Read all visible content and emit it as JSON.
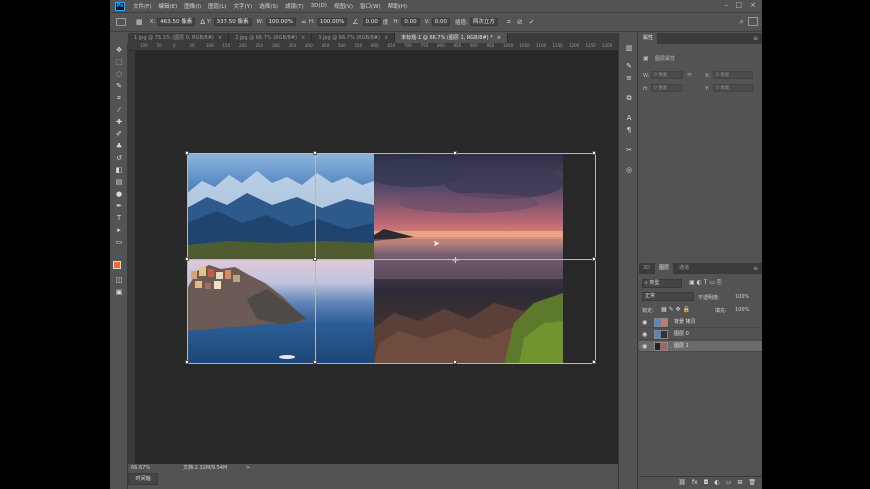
{
  "menu": {
    "items": [
      "文件(F)",
      "编辑(E)",
      "图像(I)",
      "图层(L)",
      "文字(Y)",
      "选择(S)",
      "滤镜(T)",
      "3D(D)",
      "视图(V)",
      "窗口(W)",
      "帮助(H)"
    ],
    "logo": "Ps"
  },
  "options": {
    "x_label": "X:",
    "x_value": "463.50 像素",
    "y_label": "Y:",
    "y_value": "337.50 像素",
    "w_label": "W:",
    "w_value": "100.00%",
    "h_label": "H:",
    "h_value": "100.00%",
    "angle_value": "0.00",
    "angle_unit": "度",
    "hskew_label": "H:",
    "hskew_value": "0.00",
    "vskew_label": "V:",
    "vskew_value": "0.00",
    "interp_label": "插值:",
    "interp_value": "两次立方"
  },
  "tabs": [
    {
      "label": "1.jpg @ 75.1% (图层 0, RGB/8#)",
      "close": "×"
    },
    {
      "label": "2.jpg @ 66.7% (RGB/8#)",
      "close": "×"
    },
    {
      "label": "3.jpg @ 66.7% (RGB/8#)",
      "close": "×"
    },
    {
      "label": "未标题-1 @ 66.7% (图层 1, RGB/8#) *",
      "close": "×"
    }
  ],
  "ruler": {
    "h": [
      "100",
      "50",
      "0",
      "50",
      "100",
      "150",
      "200",
      "250",
      "300",
      "350",
      "400",
      "450",
      "500",
      "550",
      "600",
      "650",
      "700",
      "750",
      "800",
      "850",
      "900",
      "950",
      "1000",
      "1050",
      "1100",
      "1150",
      "1200",
      "1250",
      "1300",
      "1350"
    ]
  },
  "status": {
    "zoom": "66.67%",
    "doc": "文档:2.32M/9.54M",
    "arrow": ">"
  },
  "timeline": "时间轴",
  "properties": {
    "tab": "属性",
    "title": "图层属性",
    "w": "W:",
    "w_val": "0 像素",
    "x": "X:",
    "x_val": "0 像素",
    "h": "H:",
    "h_val": "0 像素",
    "y": "Y:",
    "y_val": "0 像素"
  },
  "layers": {
    "tabs": [
      "3D",
      "图层",
      "通道"
    ],
    "filter": "类型",
    "blend": "正常",
    "opacity_label": "不透明度:",
    "opacity": "100%",
    "lock_label": "锁定:",
    "fill_label": "填充:",
    "fill": "100%",
    "items": [
      {
        "name": "背景 拷贝",
        "selected": false
      },
      {
        "name": "图层 0",
        "selected": false
      },
      {
        "name": "图层 1",
        "selected": true
      }
    ]
  }
}
